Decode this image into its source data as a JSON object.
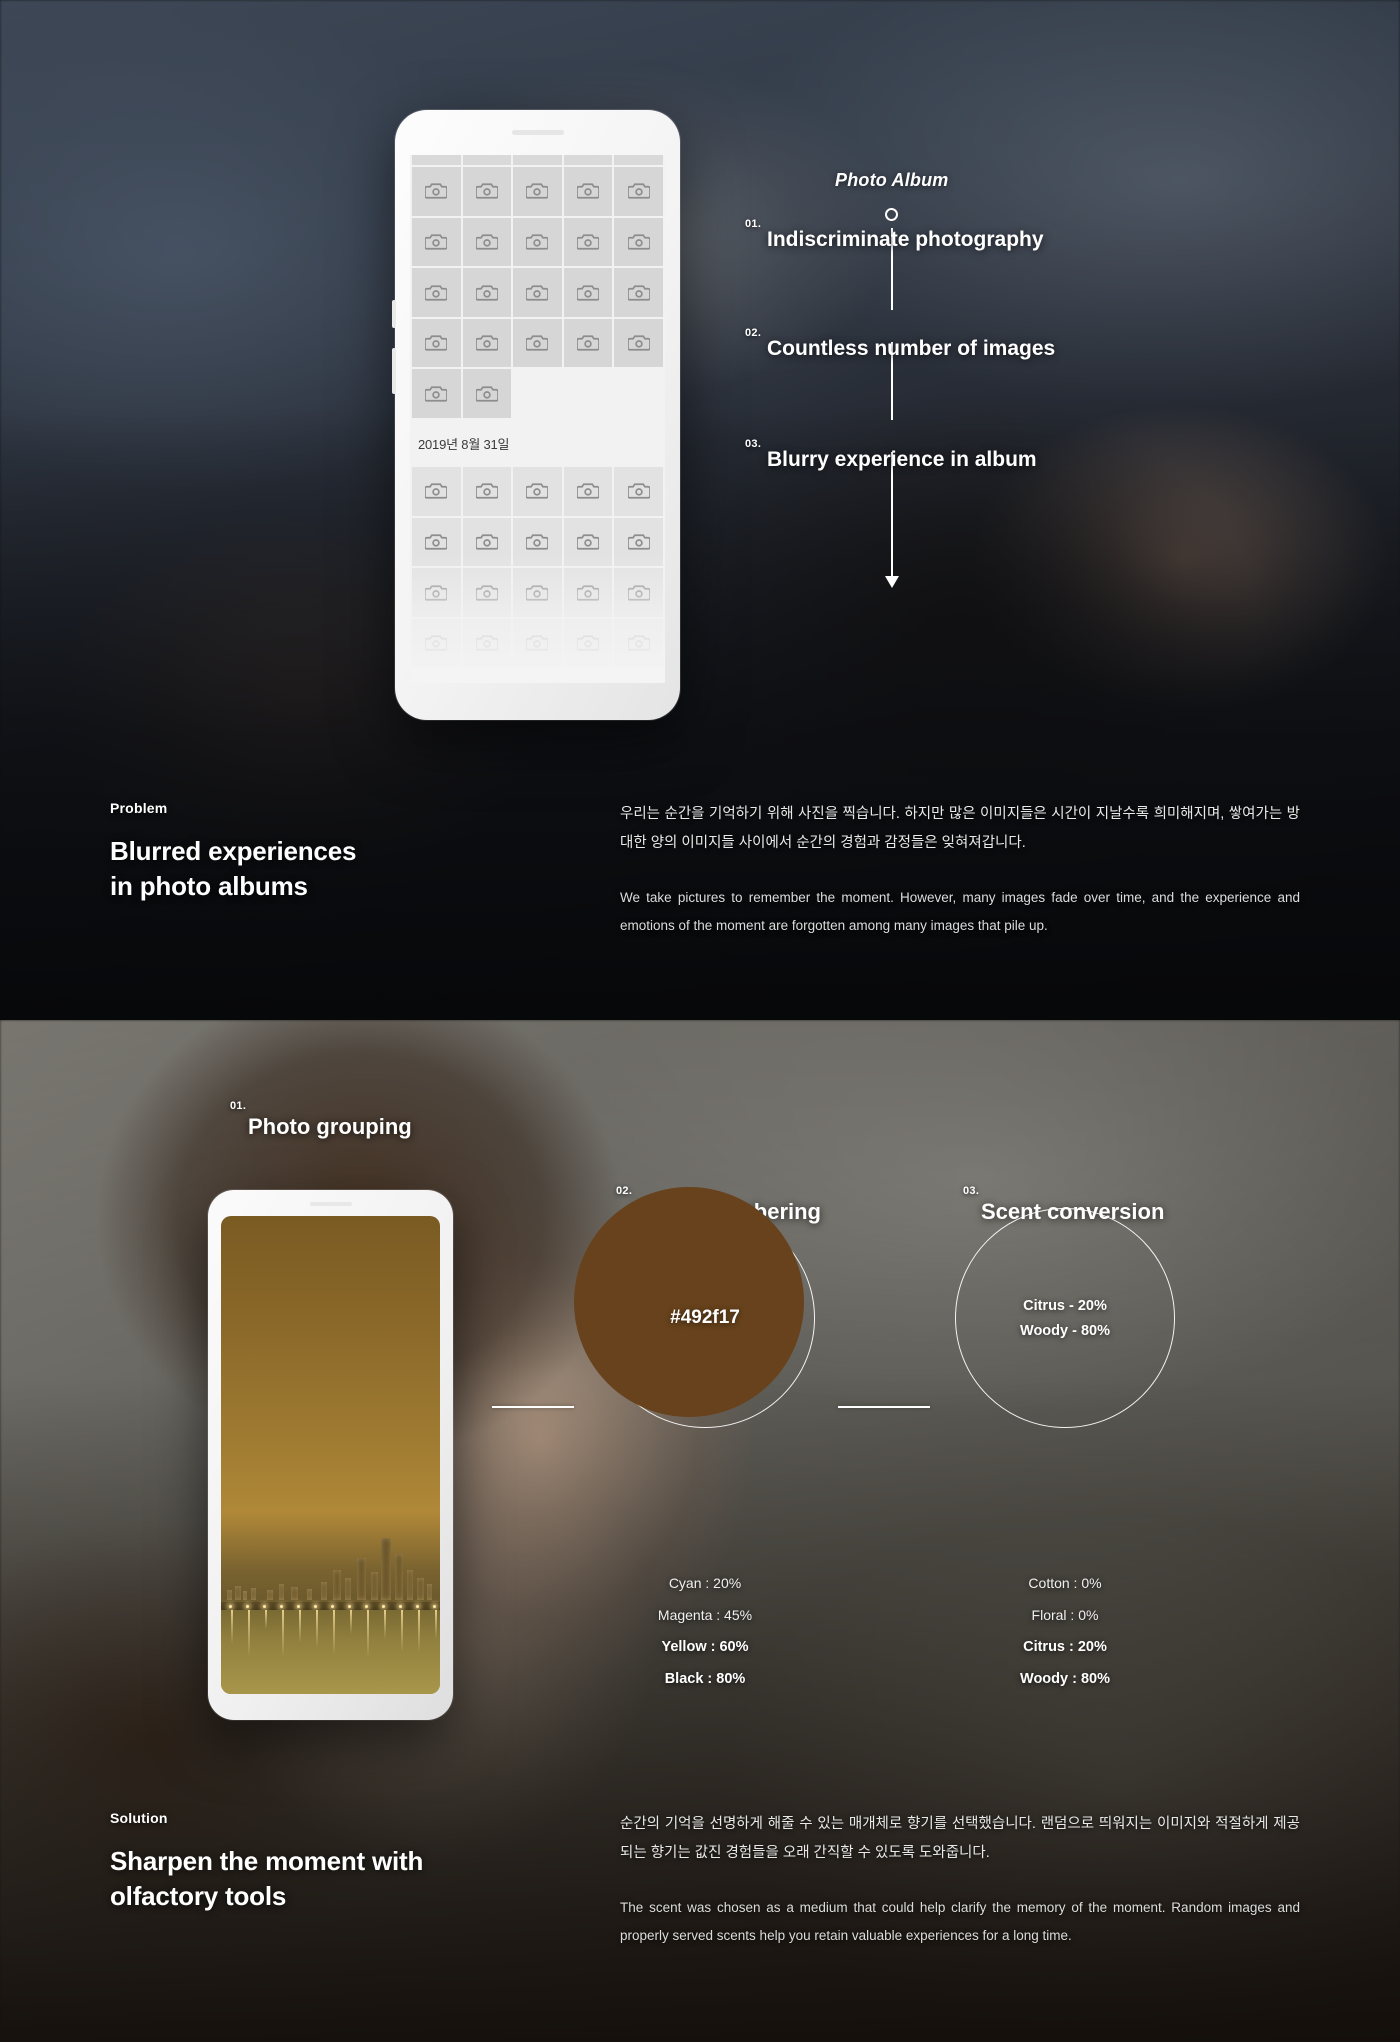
{
  "problem": {
    "phone": {
      "album_date": "2019년 8월 31일",
      "cell_icon": "camera-icon",
      "grid_columns": 5
    },
    "callouts": {
      "title": "Photo Album",
      "items": [
        {
          "num": "01.",
          "text": "Indiscriminate photography"
        },
        {
          "num": "02.",
          "text": "Countless number of images"
        },
        {
          "num": "03.",
          "text": "Blurry experience in album"
        }
      ]
    },
    "kicker": "Problem",
    "headline_line1": "Blurred experiences",
    "headline_line2": "in photo albums",
    "paragraph_ko": "우리는 순간을 기억하기 위해 사진을 찍습니다. 하지만 많은 이미지들은 시간이 지날수록 희미해지며, 쌓여가는 방대한 양의 이미지들 사이에서 순간의 경험과 감정들은 잊혀져갑니다.",
    "paragraph_en": "We take pictures to remember the moment. However, many images fade over time, and the experience and emotions of the moment are forgotten among many images that pile up."
  },
  "solution": {
    "steps": [
      {
        "num": "01.",
        "title": "Photo grouping"
      },
      {
        "num": "02.",
        "title": "CMYK Numbering"
      },
      {
        "num": "03.",
        "title": "Scent conversion"
      }
    ],
    "cmyk_circle": {
      "hex": "#492f17",
      "fill_color": "#67421c"
    },
    "scent_circle": {
      "lines": [
        "Citrus - 20%",
        "Woody - 80%"
      ]
    },
    "cmyk_values": [
      {
        "label": "Cyan : 20%",
        "emphasis": false
      },
      {
        "label": "Magenta : 45%",
        "emphasis": false
      },
      {
        "label": "Yellow : 60%",
        "emphasis": true
      },
      {
        "label": "Black : 80%",
        "emphasis": true
      }
    ],
    "scent_values": [
      {
        "label": "Cotton : 0%",
        "emphasis": false
      },
      {
        "label": "Floral : 0%",
        "emphasis": false
      },
      {
        "label": "Citrus : 20%",
        "emphasis": true
      },
      {
        "label": "Woody : 80%",
        "emphasis": true
      }
    ],
    "kicker": "Solution",
    "headline_line1": "Sharpen the moment with",
    "headline_line2": "olfactory tools",
    "paragraph_ko": "순간의 기억을 선명하게 해줄 수 있는 매개체로 향기를 선택했습니다. 랜덤으로 띄워지는 이미지와 적절하게 제공되는 향기는 값진 경험들을 오래 간직할 수 있도록 도와줍니다.",
    "paragraph_en": "The scent was chosen as a medium that could help clarify the memory of the moment. Random images and properly served scents help you retain valuable experiences for a long time."
  },
  "colors": {
    "accent_brown": "#67421c",
    "outline_white": "#ffffff",
    "text_white": "#ffffff"
  }
}
